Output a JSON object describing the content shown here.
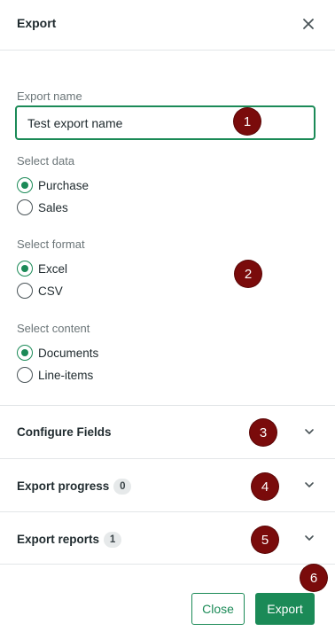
{
  "header": {
    "title": "Export",
    "close_icon": "close-icon"
  },
  "form": {
    "export_name": {
      "label": "Export name",
      "value": "Test export name"
    },
    "select_data": {
      "label": "Select data",
      "options": [
        "Purchase",
        "Sales"
      ],
      "selected": "Purchase"
    },
    "select_format": {
      "label": "Select format",
      "options": [
        "Excel",
        "CSV"
      ],
      "selected": "Excel"
    },
    "select_content": {
      "label": "Select content",
      "options": [
        "Documents",
        "Line-items"
      ],
      "selected": "Documents"
    }
  },
  "sections": [
    {
      "title": "Configure Fields",
      "badge": null,
      "icon": "chevron-down-icon"
    },
    {
      "title": "Export progress",
      "badge": "0",
      "icon": "chevron-down-icon"
    },
    {
      "title": "Export reports",
      "badge": "1",
      "icon": "chevron-down-icon"
    }
  ],
  "footer": {
    "close_label": "Close",
    "export_label": "Export"
  },
  "markers": [
    "1",
    "2",
    "3",
    "4",
    "5",
    "6"
  ],
  "colors": {
    "accent": "#1b8a57",
    "marker": "#7a0b0b",
    "border": "#e3e6e8"
  }
}
